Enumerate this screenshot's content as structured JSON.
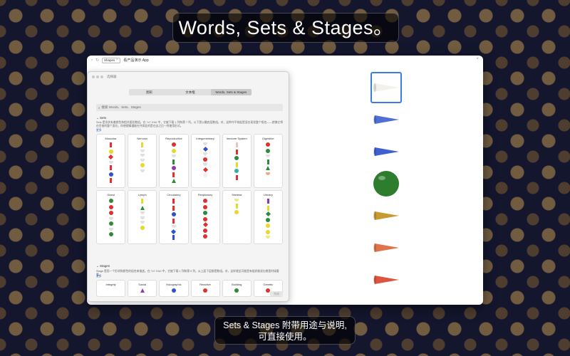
{
  "banner_top": "Words, Sets & Stages。",
  "banner_bottom": [
    "Sets & Stages 附带用途与说明,",
    "可直接使用。"
  ],
  "window": {
    "scope_label": "Shapes ⌃",
    "title": "看产品演示 App"
  },
  "panel": {
    "title": "选择器",
    "tabs": [
      {
        "label": "图形",
        "active": false
      },
      {
        "label": "文本框",
        "active": false
      },
      {
        "label": "Words, Sets & Stages",
        "active": true
      }
    ],
    "search_placeholder": "搜索 Words、Sets、Stages",
    "sets": {
      "label": "Sets",
      "description": "Sets 是形状有着颜色和相关图形数组。在 7x7 GIUI 中，它被下载 1 列和第 7 列。以下是以最底层数组。对，这种作平装起是显在现状整个框也——就像它将在目前的整个面位，你便就精通能在共如此的是在这之后一样使用形式。",
      "link": "更多",
      "cards": [
        {
          "title": "Muscular",
          "markers": [
            "bar:#e03030",
            "ball:#e8d828",
            "diamond:#e03030",
            "cone:#cccccc",
            "bar:#e03030",
            "ball:#3050d0",
            "bar:#e03030"
          ]
        },
        {
          "title": "Nervous",
          "markers": [
            "bar:#e8d828",
            "cone:#cccccc",
            "cone:#cccccc",
            "cone:#cccccc",
            "ball:#e8d828",
            "cone:#cccccc"
          ]
        },
        {
          "title": "Reproductive",
          "markers": [
            "ball:#e03030",
            "ball:#e8d828",
            "cone:#cccccc",
            "bar:#2e8b3a",
            "ball:#8e3ab0",
            "bar:#e03030",
            "tri:#2e8b3a"
          ]
        },
        {
          "title": "Integumentary",
          "markers": [
            "cone:#cccccc",
            "diamond:#3050d0",
            "cone:#cccccc",
            "ball:#e03030",
            "cone:#cccccc",
            "diamond:#e03030",
            "ball:#f0f0f0"
          ]
        },
        {
          "title": "Immune System",
          "markers": [
            "bar:#f0c0c0",
            "bar:#e03030",
            "ball:#2e8b3a",
            "bar:#e8d828",
            "ball:#30b0a0",
            "bar:#e03030"
          ]
        },
        {
          "title": "Digestive",
          "markers": [
            "ball:#e03030",
            "ball:#2e8b3a",
            "cone:#cccccc",
            "bar:#2e8b3a",
            "tri:#2e8b3a",
            "cone:#e07030"
          ]
        },
        {
          "title": "Gland",
          "markers": [
            "ball:#2e8b3a",
            "ball:#e03030",
            "ball:#e03030",
            "cone:#cccccc",
            "ball:#2e8b3a",
            "cone:#cccccc",
            "ball:#2e8b3a"
          ]
        },
        {
          "title": "Lymph",
          "markers": [
            "bar:#e8d828",
            "tri:#2e8b3a",
            "cone:#cccccc",
            "cone:#cccccc",
            "cone:#cccccc",
            "ball:#e8d828"
          ]
        },
        {
          "title": "Circulatory",
          "markers": [
            "bar:#e03030",
            "bar:#e03030",
            "ball:#3050d0",
            "bar:#e03030",
            "cone:#cccccc",
            "diamond:#3050d0",
            "bar:#3050d0"
          ]
        },
        {
          "title": "Respiratory",
          "markers": [
            "ball:#e03030",
            "ball:#e03030",
            "ball:#2e8b3a",
            "ball:#e03030",
            "diamond:#e03030",
            "ball:#e03030",
            "ball:#e03030"
          ]
        },
        {
          "title": "Skeletal",
          "markers": [
            "cone:#e8d828",
            "bar:#e8d828",
            "ball:#e8d828"
          ]
        },
        {
          "title": "Urinary",
          "markers": [
            "bar:#8e3ab0",
            "bar:#e8d828",
            "diamond:#2e8b3a",
            "ball:#2e8b3a",
            "ball:#e8d828",
            "ball:#e8d828",
            "cone:#e8d828"
          ]
        }
      ]
    },
    "stages": {
      "label": "Stages",
      "description": "Stage 是用一个形状和颜色的组合来描述。在 7x7 GIUI 中，它被下载 1 列和第 5 列，从上面下层都是数组。对，这样就此可能是有组织能说出哪里时候看看。",
      "link": "更多",
      "cards": [
        {
          "title": "Integrity",
          "markers": []
        },
        {
          "title": "Social",
          "markers": [
            "tri:#8e3ab0"
          ]
        },
        {
          "title": "Holographic",
          "markers": [
            "ball:#3050d0"
          ]
        },
        {
          "title": "Reactive",
          "markers": [
            "ball:#e03030"
          ]
        },
        {
          "title": "Building",
          "markers": [
            "ball:#2e8b3a"
          ]
        },
        {
          "title": "Genetic",
          "markers": [
            "ball:#e03030"
          ]
        }
      ]
    },
    "done_label": "完成"
  },
  "thumbnails": [
    {
      "name": "white-cone",
      "color": "#f2f2ea",
      "selected": true
    },
    {
      "name": "blue-cone",
      "color": "#4d6fd6",
      "selected": false
    },
    {
      "name": "blue-cone",
      "color": "#3f60cf",
      "selected": false
    },
    {
      "name": "green-sphere",
      "color": "#2e7d2e",
      "selected": false
    },
    {
      "name": "gold-cone",
      "color": "#c89a30",
      "selected": false
    },
    {
      "name": "orange-cone",
      "color": "#e0734a",
      "selected": false
    },
    {
      "name": "red-cone",
      "color": "#dd5540",
      "selected": false
    }
  ]
}
